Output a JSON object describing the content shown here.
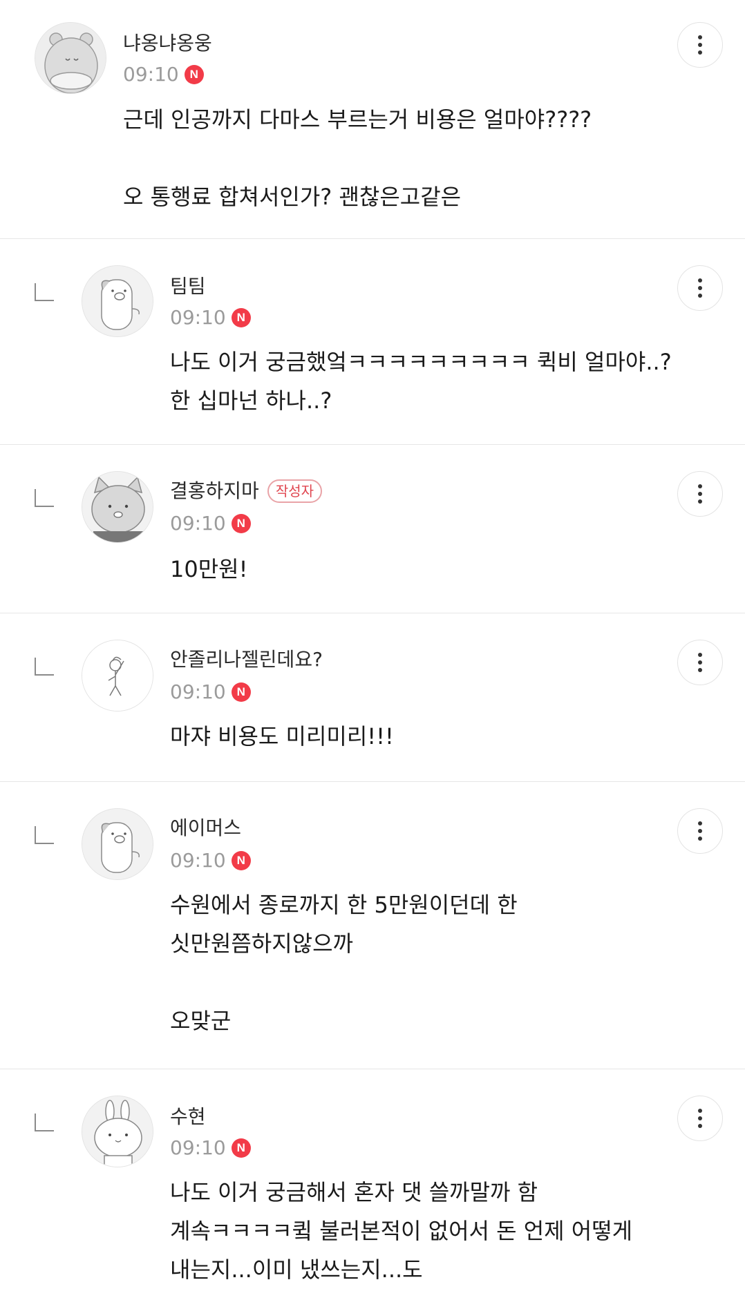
{
  "colors": {
    "new_badge": "#f23b48",
    "writer_badge": "#e0454f",
    "divider": "#e6e6e6",
    "time": "#9b9b9b"
  },
  "comments": [
    {
      "author": "냐옹냐옹웅",
      "time": "09:10",
      "new_label": "N",
      "text": "근데 인공까지 다마스 부르는거 비용은 얼마야????\n\n오 통행료 합쳐서인가? 괜찮은고같은",
      "avatar_icon": "hamster-avatar-icon",
      "is_reply": false
    },
    {
      "author": "팀팀",
      "time": "09:10",
      "new_label": "N",
      "text": "나도 이거 궁금했엌ㅋㅋㅋㅋㅋㅋㅋㅋㅋ 퀵비 얼마야..? 한 십마넌 하나..?",
      "avatar_icon": "pig-avatar-icon",
      "is_reply": true
    },
    {
      "author": "결홍하지마",
      "writer_badge": "작성자",
      "time": "09:10",
      "new_label": "N",
      "text": "10만원!",
      "avatar_icon": "cat-avatar-icon",
      "is_reply": true
    },
    {
      "author": "안졸리나젤린데요?",
      "time": "09:10",
      "new_label": "N",
      "text": "마쟈 비용도 미리미리!!!",
      "avatar_icon": "stick-figure-avatar-icon",
      "is_reply": true
    },
    {
      "author": "에이머스",
      "time": "09:10",
      "new_label": "N",
      "text": "수원에서 종로까지 한 5만원이던데 한 싯만원쯤하지않으까\n\n오맞군",
      "avatar_icon": "pig-avatar-icon",
      "is_reply": true
    },
    {
      "author": "수현",
      "time": "09:10",
      "new_label": "N",
      "text": "나도 이거 궁금해서 혼자 댓 쓸까말까 함 계속ㅋㅋㅋㅋ큌 불러본적이 없어서 돈 언제 어떻게 내는지...이미 냈쓰는지...도",
      "avatar_icon": "rabbit-avatar-icon",
      "is_reply": true
    }
  ]
}
